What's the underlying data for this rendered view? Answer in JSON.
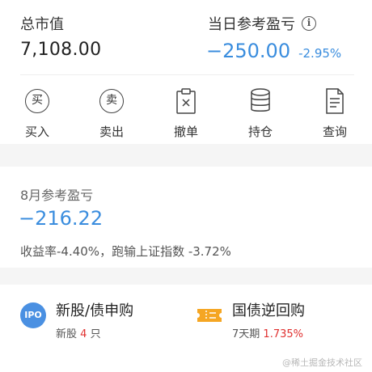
{
  "summary": {
    "total_label": "总市值",
    "total_value": "7,108.00",
    "pnl_label": "当日参考盈亏",
    "pnl_info_glyph": "i",
    "pnl_value": "−250.00",
    "pnl_percent": "-2.95%"
  },
  "actions": [
    {
      "label": "买入",
      "glyph": "买",
      "icon": "buy-icon"
    },
    {
      "label": "卖出",
      "glyph": "卖",
      "icon": "sell-icon"
    },
    {
      "label": "撤单",
      "icon": "cancel-order-icon"
    },
    {
      "label": "持仓",
      "icon": "position-icon"
    },
    {
      "label": "查询",
      "icon": "query-icon"
    }
  ],
  "monthly": {
    "label": "8月参考盈亏",
    "value": "−216.22",
    "desc": "收益率-4.40%，跑输上证指数 -3.72%"
  },
  "features": {
    "ipo": {
      "icon_text": "IPO",
      "title": "新股/债申购",
      "sub_prefix": "新股",
      "sub_count": "4",
      "sub_suffix": "只"
    },
    "bond": {
      "title": "国债逆回购",
      "sub_prefix": "7天期",
      "sub_rate": "1.735%"
    }
  },
  "watermark": "@稀土掘金技术社区",
  "colors": {
    "loss_blue": "#3a8dde",
    "gain_red": "#e0302f",
    "ipo_blue": "#4a90e2",
    "ticket_orange": "#f5a623"
  }
}
